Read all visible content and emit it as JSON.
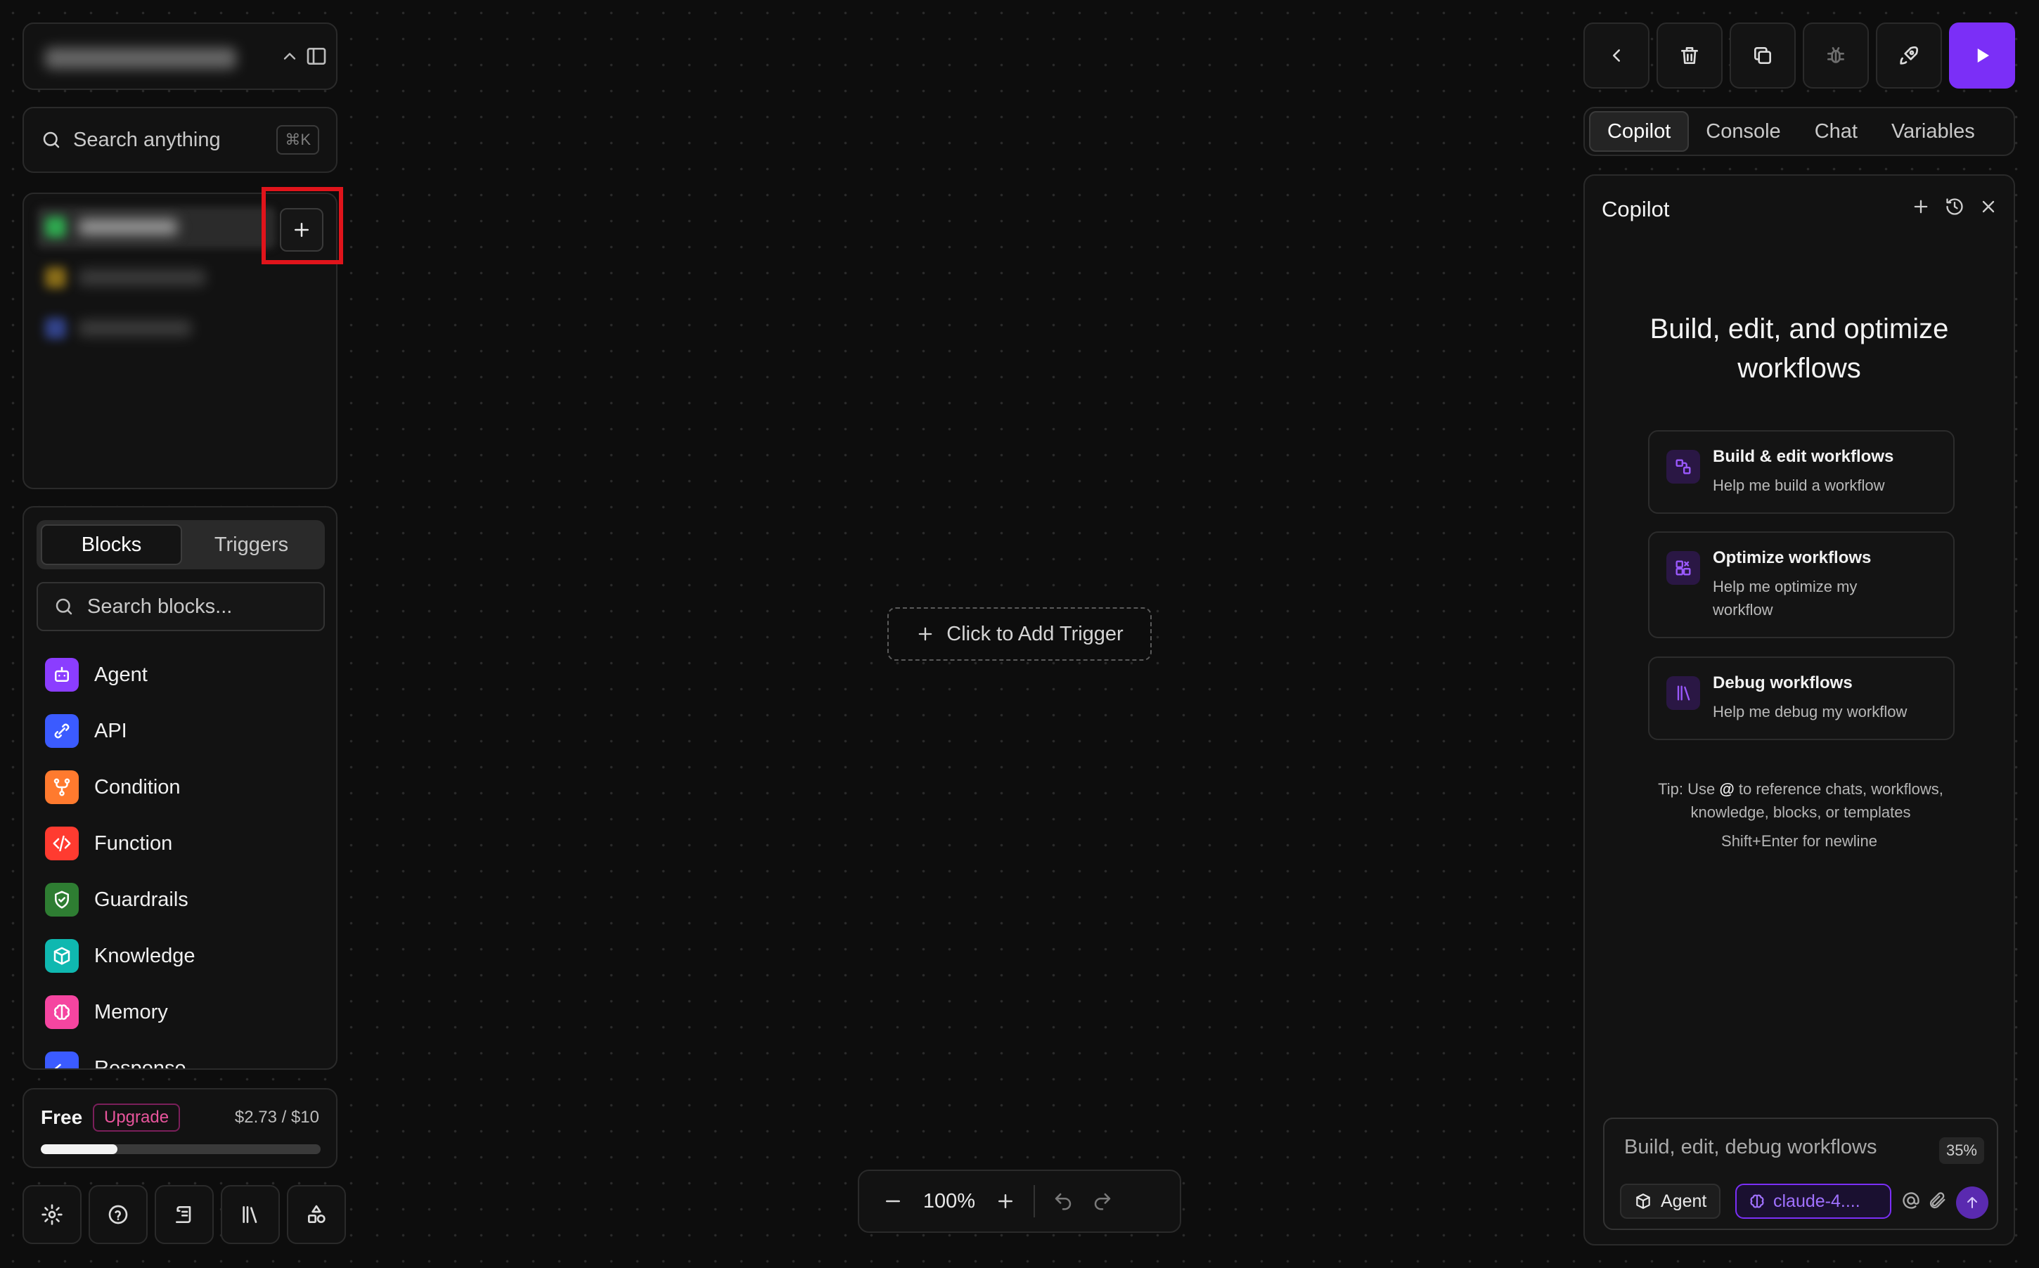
{
  "sidebar": {
    "search": {
      "placeholder": "Search anything",
      "shortcut": "⌘K"
    },
    "blocks": {
      "tabs": [
        "Blocks",
        "Triggers"
      ],
      "search_placeholder": "Search blocks...",
      "items": [
        {
          "label": "Agent",
          "icon": "robot-icon",
          "color": "#8b3dff"
        },
        {
          "label": "API",
          "icon": "link-icon",
          "color": "#3b5bff"
        },
        {
          "label": "Condition",
          "icon": "branch-icon",
          "color": "#ff7a2e"
        },
        {
          "label": "Function",
          "icon": "code-icon",
          "color": "#ff3b30"
        },
        {
          "label": "Guardrails",
          "icon": "shield-check-icon",
          "color": "#2e7d32"
        },
        {
          "label": "Knowledge",
          "icon": "package-icon",
          "color": "#0fb8b0"
        },
        {
          "label": "Memory",
          "icon": "brain-icon",
          "color": "#f545a0"
        },
        {
          "label": "Response",
          "icon": "reply-icon",
          "color": "#3b5bff"
        }
      ]
    },
    "usage": {
      "plan": "Free",
      "upgrade_label": "Upgrade",
      "usage_text": "$2.73 / $10",
      "usage_fraction": 0.273
    },
    "bottom_tools": [
      "settings-icon",
      "help-icon",
      "logs-icon",
      "library-icon",
      "templates-icon"
    ]
  },
  "canvas": {
    "add_trigger_label": "Click to Add Trigger",
    "zoom_level": "100%"
  },
  "right_panel": {
    "tabs": [
      "Copilot",
      "Console",
      "Chat",
      "Variables"
    ],
    "active_tab": "Copilot",
    "copilot": {
      "title": "Copilot",
      "heading": "Build, edit, and optimize workflows",
      "suggestions": [
        {
          "title": "Build & edit workflows",
          "subtitle": "Help me build a workflow"
        },
        {
          "title": "Optimize workflows",
          "subtitle": "Help me optimize my workflow"
        },
        {
          "title": "Debug workflows",
          "subtitle": "Help me debug my workflow"
        }
      ],
      "tip_prefix": "Tip: Use ",
      "tip_symbol": "@",
      "tip_suffix": " to reference chats, workflows, knowledge, blocks, or templates",
      "newline_hint": "Shift+Enter for newline",
      "composer": {
        "placeholder": "Build, edit, debug workflows",
        "context_percent": "35%",
        "mode": "Agent",
        "model": "claude-4...."
      }
    }
  },
  "colors": {
    "accent": "#7b2ff7",
    "highlight": "#e0141b",
    "background": "#0d0d0d"
  }
}
